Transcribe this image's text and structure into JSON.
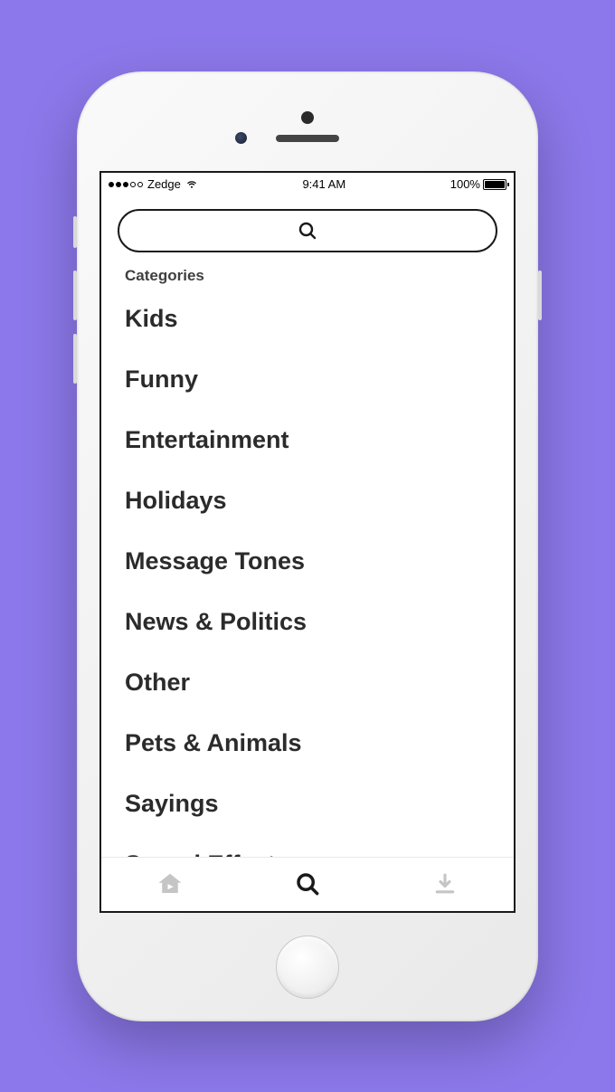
{
  "status": {
    "carrier": "Zedge",
    "time": "9:41 AM",
    "battery_pct": "100%"
  },
  "section_label": "Categories",
  "categories": [
    "Kids",
    "Funny",
    "Entertainment",
    "Holidays",
    "Message Tones",
    "News & Politics",
    "Other",
    "Pets & Animals",
    "Sayings",
    "Sound Effects"
  ]
}
